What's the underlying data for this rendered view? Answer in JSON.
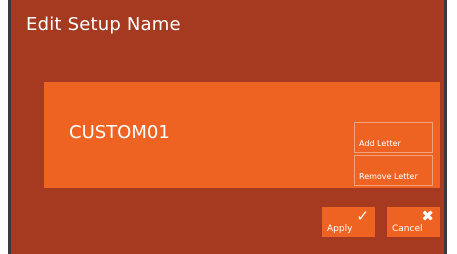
{
  "dialog": {
    "title": "Edit Setup Name",
    "setup_name": "CUSTOM01",
    "add_letter_label": "Add Letter",
    "remove_letter_label": "Remove Letter",
    "apply_label": "Apply",
    "cancel_label": "Cancel",
    "apply_icon": "✓",
    "cancel_icon": "✖"
  },
  "colors": {
    "dialog_bg": "#a63a20",
    "panel_bg": "#ee6322",
    "button_bg": "#ee6322",
    "text": "#ffffff"
  }
}
